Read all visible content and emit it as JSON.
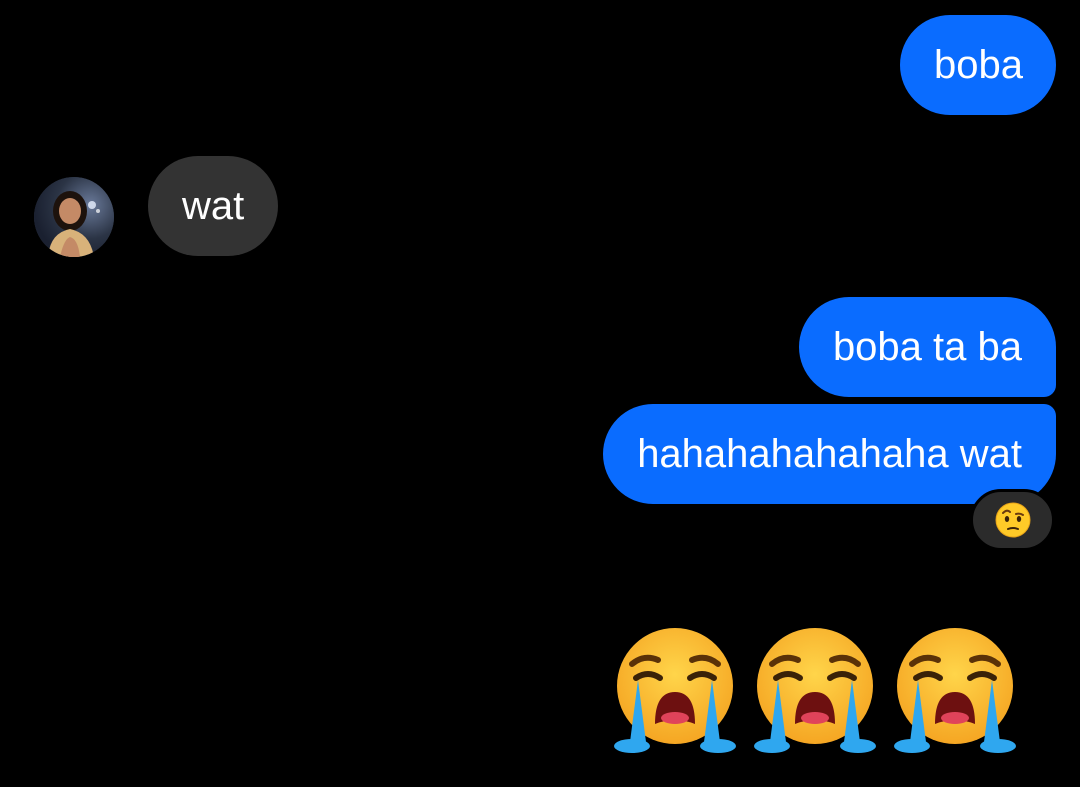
{
  "conversation": {
    "messages": [
      {
        "sender": "me",
        "text": "boba"
      },
      {
        "sender": "contact",
        "text": "wat"
      },
      {
        "sender": "me",
        "text": "boba ta ba"
      },
      {
        "sender": "me",
        "text": "hahahahahahaha wat",
        "reaction": "face-with-raised-eyebrow"
      },
      {
        "sender": "me",
        "emoji": [
          "loudly-crying-face",
          "loudly-crying-face",
          "loudly-crying-face"
        ]
      }
    ]
  },
  "colors": {
    "background": "#000000",
    "sent_bubble": "#0a6cff",
    "received_bubble": "#333333",
    "text": "#ffffff"
  },
  "icons": {
    "avatar": "contact-avatar",
    "reaction": "face-with-raised-eyebrow-icon",
    "big_emoji": "loudly-crying-face-icon"
  }
}
